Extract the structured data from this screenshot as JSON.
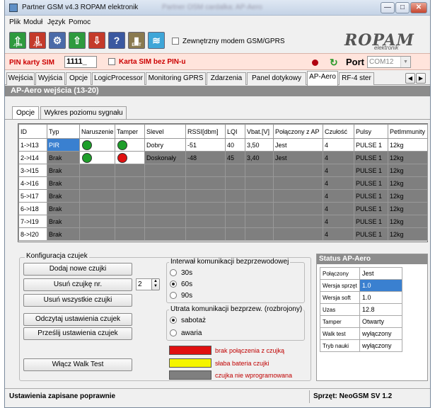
{
  "window": {
    "title": "Partner GSM v4.3 ROPAM elektronik",
    "title_blurred": "Partner OSM cardalka: AP-Aero",
    "min": "—",
    "max": "□",
    "close": "✕"
  },
  "menu": [
    "Plik",
    "Moduł",
    "Język",
    "Pomoc"
  ],
  "toolbar": {
    "buttons": [
      {
        "icon": "open-rpm-icon",
        "label": ".rpm",
        "color": "#2e9a3e"
      },
      {
        "icon": "save-rpm-icon",
        "label": ".rpm",
        "color": "#c43a2a"
      },
      {
        "icon": "settings-icon",
        "label": "",
        "color": "#4a6aa8"
      },
      {
        "icon": "upload-icon",
        "label": "",
        "color": "#2e9a3e"
      },
      {
        "icon": "download-icon",
        "label": "",
        "color": "#c43a2a"
      },
      {
        "icon": "help-icon",
        "label": "?",
        "color": "#3a58a0"
      },
      {
        "icon": "exit-icon",
        "label": "EXIT",
        "color": "#8a7a50"
      },
      {
        "icon": "wireless-icon",
        "label": "",
        "color": "#3fa6d8"
      }
    ],
    "external_modem_label": "Zewnętrzny modem GSM/GPRS",
    "logo_text": "ROPAM",
    "logo_sub": "elektronik"
  },
  "pinbar": {
    "pin_label": "PIN karty SIM",
    "pin_value": "1111_",
    "no_pin_label": "Karta SIM bez PIN-u",
    "port_label": "Port",
    "port_value": "COM12"
  },
  "tabs": [
    "Wejścia",
    "Wyjścia",
    "Opcje",
    "LogicProcessor",
    "Monitoring GPRS",
    "Zdarzenia",
    "Panel dotykowy",
    "AP-Aero",
    "RF-4 ster"
  ],
  "section_title": "AP-Aero  wejścia  (13-20)",
  "subtabs": [
    "Opcje",
    "Wykres poziomu sygnału"
  ],
  "grid": {
    "headers": [
      "ID",
      "Typ",
      "Naruszenie",
      "Tamper",
      "Slevel",
      "RSSI[dbm]",
      "LQI",
      "Vbat.[V]",
      "Połączony z AP",
      "Czułość",
      "Pulsy",
      "PetImmunity"
    ],
    "rows": [
      {
        "id": "1->I13",
        "typ": "PIR",
        "naruszenie": "#1e9e2a",
        "tamper": "#1e9e2a",
        "slevel": "Dobry",
        "rssi": "-51",
        "lqi": "40",
        "vbat": "3,50",
        "ap": "Jest",
        "czulosc": "4",
        "pulsy": "PULSE 1",
        "pet": "12kg"
      },
      {
        "id": "2->I14",
        "typ": "Brak",
        "naruszenie": "#1e9e2a",
        "tamper": "#e01010",
        "slevel": "Doskonały",
        "rssi": "-48",
        "lqi": "45",
        "vbat": "3,40",
        "ap": "Jest",
        "czulosc": "4",
        "pulsy": "PULSE 1",
        "pet": "12kg"
      },
      {
        "id": "3->I15",
        "typ": "Brak",
        "czulosc": "4",
        "pulsy": "PULSE 1",
        "pet": "12kg"
      },
      {
        "id": "4->I16",
        "typ": "Brak",
        "czulosc": "4",
        "pulsy": "PULSE 1",
        "pet": "12kg"
      },
      {
        "id": "5->I17",
        "typ": "Brak",
        "czulosc": "4",
        "pulsy": "PULSE 1",
        "pet": "12kg"
      },
      {
        "id": "6->I18",
        "typ": "Brak",
        "czulosc": "4",
        "pulsy": "PULSE 1",
        "pet": "12kg"
      },
      {
        "id": "7->I19",
        "typ": "Brak",
        "czulosc": "4",
        "pulsy": "PULSE 1",
        "pet": "12kg"
      },
      {
        "id": "8->I20",
        "typ": "Brak",
        "czulosc": "4",
        "pulsy": "PULSE 1",
        "pet": "12kg"
      }
    ]
  },
  "config": {
    "title": "Konfiguracja czujek",
    "add": "Dodaj nowe czujki",
    "remove_nr": "Usuń czujkę nr.",
    "remove_nr_value": "2",
    "remove_all": "Usuń wszystkie czujki",
    "read": "Odczytaj ustawienia czujek",
    "send": "Prześlij ustawienia czujek",
    "walk": "Włącz Walk Test",
    "interval_title": "Interwał komunikacji bezprzewodowej",
    "interval_options": [
      "30s",
      "60s",
      "90s"
    ],
    "interval_selected": "60s",
    "loss_title": "Utrata komunikacji bezprzew. (rozbrojony)",
    "loss_options": [
      "sabotaż",
      "awaria"
    ],
    "loss_selected": "sabotaż",
    "legend": [
      {
        "color": "#e01010",
        "text": "brak połączenia z czujką"
      },
      {
        "color": "#f5f500",
        "text": "słaba bateria czujki"
      },
      {
        "color": "#7f7f7f",
        "text": "czujka nie wprogramowana"
      }
    ]
  },
  "status": {
    "title": "Status AP-Aero",
    "rows": [
      {
        "k": "Połączony",
        "v": "Jest"
      },
      {
        "k": "Wersja sprzęt",
        "v": "1.0"
      },
      {
        "k": "Wersja soft",
        "v": "1.0"
      },
      {
        "k": "Uzas",
        "v": "12.8"
      },
      {
        "k": "Tamper",
        "v": "Otwarty"
      },
      {
        "k": "Walk test",
        "v": "wyłączony"
      },
      {
        "k": "Tryb nauki",
        "v": "wyłączony"
      }
    ]
  },
  "statusbar": {
    "left": "Ustawienia zapisane poprawnie",
    "right": "Sprzęt: NeoGSM SV 1.2"
  },
  "colors": {
    "accent": "#3a80d0",
    "pinbar_bg": "#ffe4dc",
    "grey_row": "#7f7f7f"
  }
}
